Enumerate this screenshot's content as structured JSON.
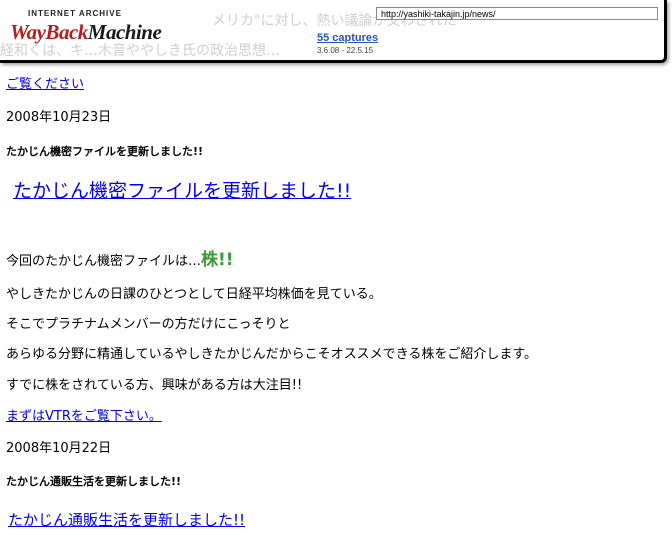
{
  "toolbar": {
    "logo_top": "INTERNET ARCHIVE",
    "logo_way": "WayBack",
    "logo_machine": "Machine",
    "url": "http://yashiki-takajin.jp/news/",
    "captures": "55 captures",
    "range": "3.6.08 - 22.5.15",
    "ghost_line_1": "メリカ\"に対し、熱い議論が交わされた",
    "ghost_line_2": "経和くは、キ…木音ややしき氏の政治思想…"
  },
  "content": {
    "view_link": "ご覧ください",
    "date_1": "2008年10月23日",
    "post_1_title": "たかじん機密ファイルを更新しました!!",
    "post_1_link": "たかじん機密ファイルを更新しました!!",
    "para_1_prefix": "今回のたかじん機密ファイルは…",
    "para_1_highlight": "株!!",
    "para_2": "やしきたかじんの日課のひとつとして日経平均株価を見ている。",
    "para_3": "そこでプラチナムメンバーの方だけにこっそりと",
    "para_4": "あらゆる分野に精通しているやしきたかじんだからこそオススメできる株をご紹介します。",
    "para_5": "すでに株をされている方、興味がある方は大注目!!",
    "vtr_link": "まずはVTRをご覧下さい。",
    "date_2": "2008年10月22日",
    "post_2_title": "たかじん通販生活を更新しました!!",
    "post_2_link": "たかじん通販生活を更新しました!!"
  },
  "colors": {
    "link": "#0000ee",
    "highlight_green": "#3a9a3a",
    "wayback_red": "#b81c1c"
  }
}
